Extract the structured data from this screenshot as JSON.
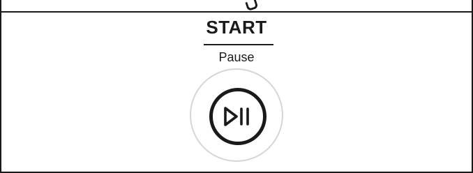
{
  "control": {
    "primary_label": "START",
    "secondary_label": "Pause",
    "button_icon": "play-pause-icon"
  },
  "colors": {
    "ink": "#1a1a1a",
    "halo": "#d6d6d6",
    "background": "#ffffff"
  }
}
